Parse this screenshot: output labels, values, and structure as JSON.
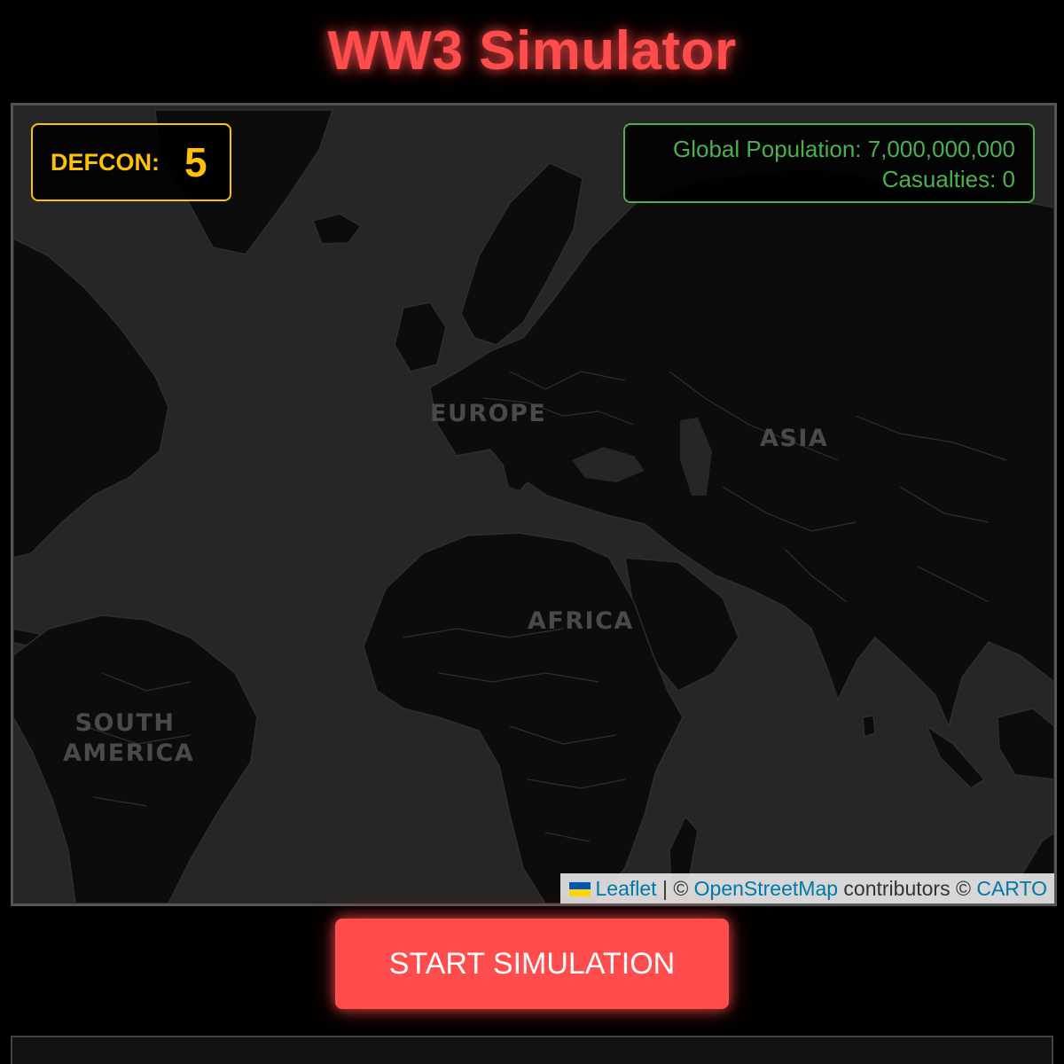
{
  "header": {
    "title": "WW3 Simulator"
  },
  "defcon": {
    "label": "DEFCON:",
    "value": "5"
  },
  "stats": {
    "population_text": "Global Population: 7,000,000,000",
    "casualties_text": "Casualties: 0"
  },
  "map": {
    "regions": {
      "europe": "EUROPE",
      "asia": "ASIA",
      "africa": "AFRICA",
      "south_america_line1": "SOUTH",
      "south_america_line2": "AMERICA"
    },
    "attribution": {
      "flag_icon": "ukraine-flag-icon",
      "leaflet": "Leaflet",
      "separator": " | © ",
      "osm": "OpenStreetMap",
      "contributors": " contributors © ",
      "carto": "CARTO"
    }
  },
  "controls": {
    "start_label": "START SIMULATION"
  },
  "colors": {
    "accent": "#ff4d4d",
    "defcon": "#ffc107",
    "stats": "#4caf50",
    "map_water": "#262626",
    "map_land": "#0c0c0c",
    "link": "#0078a8"
  }
}
